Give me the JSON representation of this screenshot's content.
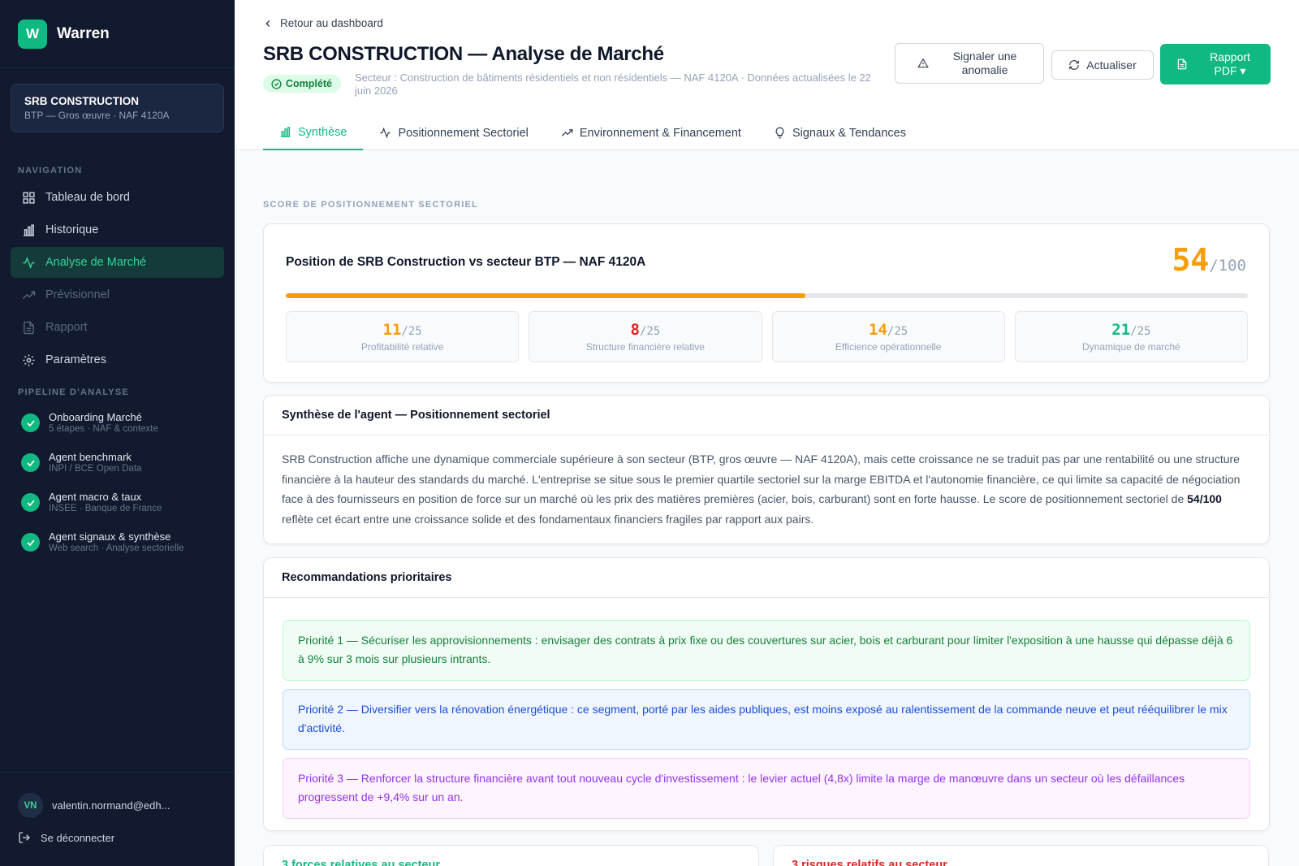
{
  "brand": {
    "logo_letter": "W",
    "name": "Warren"
  },
  "company": {
    "name": "SRB CONSTRUCTION",
    "sub": "BTP — Gros œuvre · NAF 4120A"
  },
  "sidebar": {
    "nav_label": "NAVIGATION",
    "nav": [
      {
        "label": "Tableau de bord",
        "icon": "grid-icon"
      },
      {
        "label": "Historique",
        "icon": "bar-chart-icon"
      },
      {
        "label": "Analyse de Marché",
        "icon": "activity-icon",
        "active": true
      },
      {
        "label": "Prévisionnel",
        "icon": "trending-up-icon",
        "disabled": true
      },
      {
        "label": "Rapport",
        "icon": "file-icon",
        "disabled": true
      },
      {
        "label": "Paramètres",
        "icon": "gear-icon"
      }
    ],
    "pipeline_label": "PIPELINE D'ANALYSE",
    "pipeline": [
      {
        "title": "Onboarding Marché",
        "sub": "5 étapes · NAF & contexte"
      },
      {
        "title": "Agent benchmark",
        "sub": "INPI / BCE Open Data"
      },
      {
        "title": "Agent macro & taux",
        "sub": "INSEE · Banque de France"
      },
      {
        "title": "Agent signaux & synthèse",
        "sub": "Web search · Analyse sectorielle"
      }
    ],
    "user": {
      "initials": "VN",
      "email": "valentin.normand@edh..."
    },
    "logout_label": "Se déconnecter"
  },
  "header": {
    "back_label": "Retour au dashboard",
    "title": "SRB CONSTRUCTION — Analyse de Marché",
    "status": "Complété",
    "sector_text": "Secteur : Construction de bâtiments résidentiels et non résidentiels — NAF 4120A · Données actualisées le 22 juin 2026",
    "buttons": {
      "report_anomaly": "Signaler une anomalie",
      "refresh": "Actualiser",
      "pdf": "Rapport PDF ▾"
    },
    "tabs": [
      {
        "label": "Synthèse",
        "icon": "bar-chart-icon",
        "active": true
      },
      {
        "label": "Positionnement Sectoriel",
        "icon": "activity-icon"
      },
      {
        "label": "Environnement & Financement",
        "icon": "trending-up-icon"
      },
      {
        "label": "Signaux & Tendances",
        "icon": "lightbulb-icon"
      }
    ]
  },
  "score": {
    "eyebrow": "SCORE DE POSITIONNEMENT SECTORIEL",
    "title": "Position de SRB Construction vs secteur BTP — NAF 4120A",
    "value": "54",
    "max": "/100",
    "progress_fraction": 0.54,
    "accent": "#f59e0b",
    "subscores": [
      {
        "value": "11",
        "max": "/25",
        "label": "Profitabilité relative",
        "color": "#f59e0b"
      },
      {
        "value": "8",
        "max": "/25",
        "label": "Structure financière relative",
        "color": "#dc2626"
      },
      {
        "value": "14",
        "max": "/25",
        "label": "Efficience opérationnelle",
        "color": "#f59e0b"
      },
      {
        "value": "21",
        "max": "/25",
        "label": "Dynamique de marché",
        "color": "#10b981"
      }
    ]
  },
  "synthesis": {
    "title": "Synthèse de l'agent — Positionnement sectoriel",
    "text_before": "SRB Construction affiche une dynamique commerciale supérieure à son secteur (BTP, gros œuvre — NAF 4120A), mais cette croissance ne se traduit pas par une rentabilité ou une structure financière à la hauteur des standards du marché. L'entreprise se situe sous le premier quartile sectoriel sur la marge EBITDA et l'autonomie financière, ce qui limite sa capacité de négociation face à des fournisseurs en position de force sur un marché où les prix des matières premières (acier, bois, carburant) sont en forte hausse. Le score de positionnement sectoriel de ",
    "text_bold": "54/100",
    "text_after": " reflète cet écart entre une croissance solide et des fondamentaux financiers fragiles par rapport aux pairs."
  },
  "recommendations": {
    "title": "Recommandations prioritaires",
    "items": [
      "Priorité 1 — Sécuriser les approvisionnements : envisager des contrats à prix fixe ou des couvertures sur acier, bois et carburant pour limiter l'exposition à une hausse qui dépasse déjà 6 à 9% sur 3 mois sur plusieurs intrants.",
      "Priorité 2 — Diversifier vers la rénovation énergétique : ce segment, porté par les aides publiques, est moins exposé au ralentissement de la commande neuve et peut rééquilibrer le mix d'activité.",
      "Priorité 3 — Renforcer la structure financière avant tout nouveau cycle d'investissement : le levier actuel (4,8x) limite la marge de manœuvre dans un secteur où les défaillances progressent de +9,4% sur un an."
    ]
  },
  "bottom": {
    "strengths_title": "3 forces relatives au secteur",
    "risks_title": "3 risques relatifs au secteur"
  }
}
